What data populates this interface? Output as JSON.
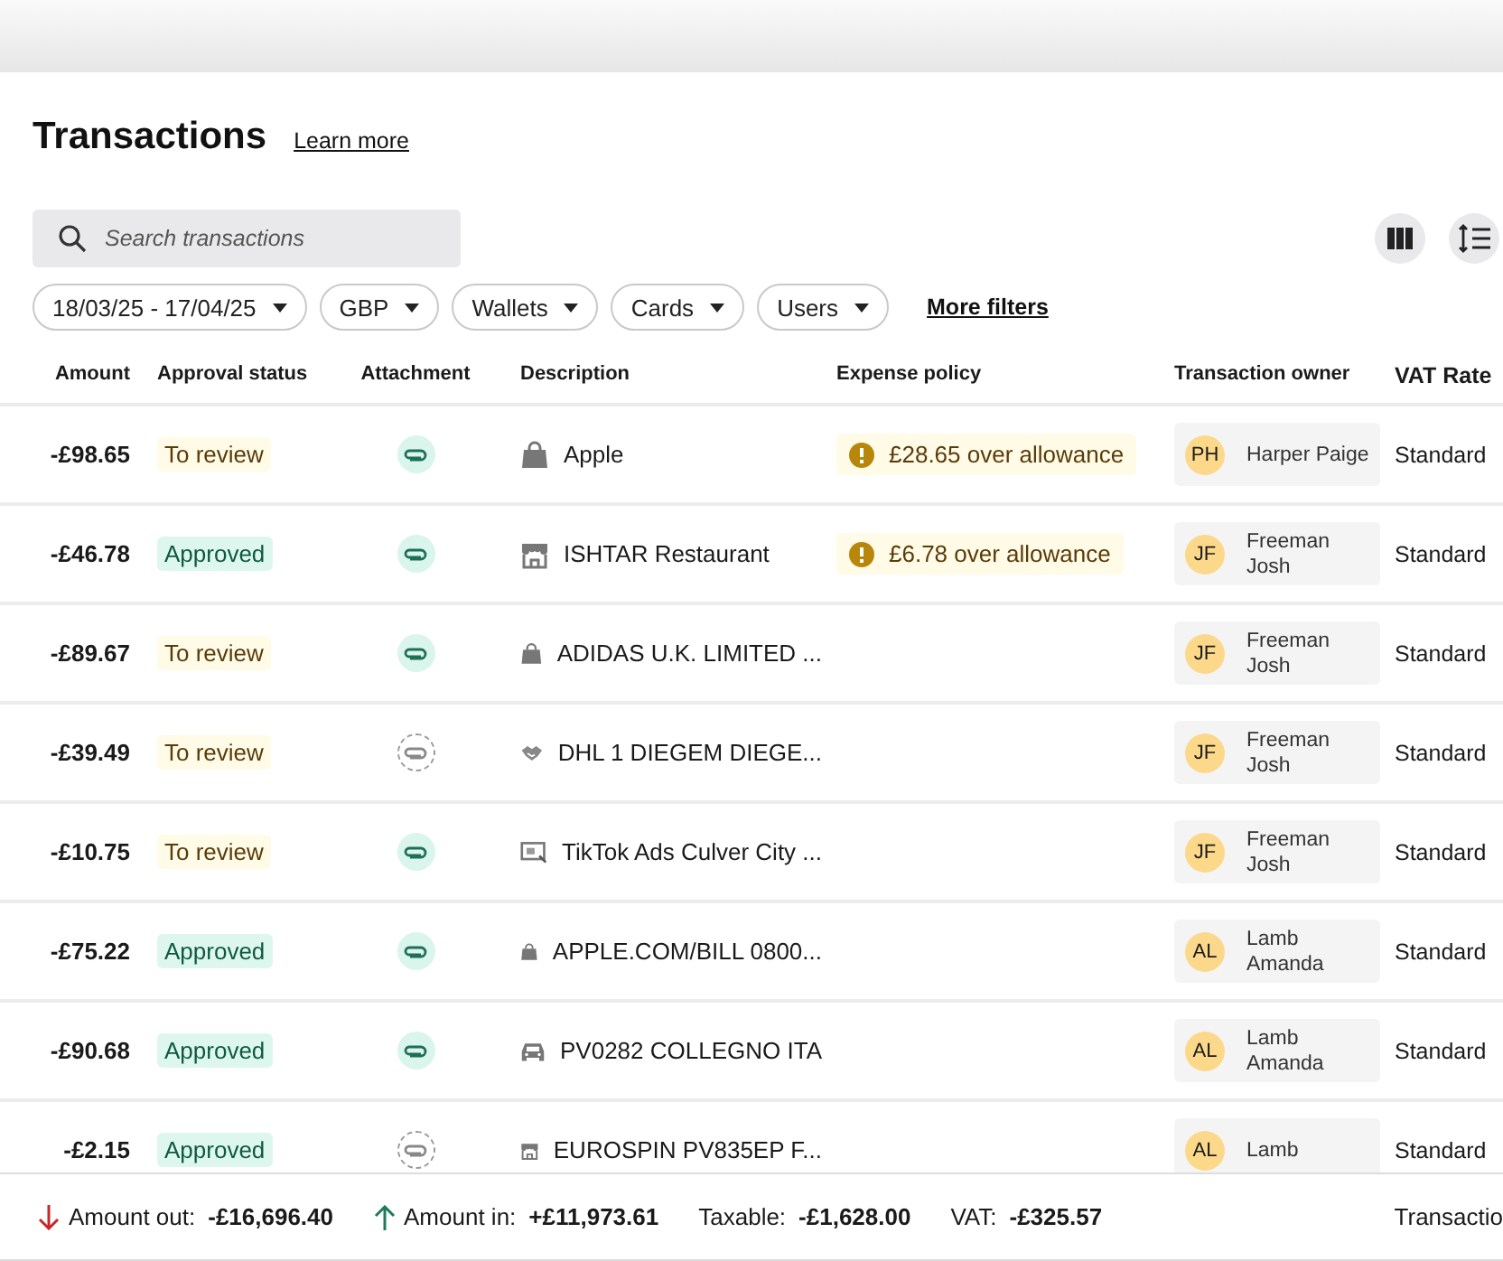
{
  "header": {
    "title": "Transactions",
    "learn_more": "Learn more"
  },
  "search": {
    "placeholder": "Search transactions"
  },
  "filters": [
    "18/03/25 - 17/04/25",
    "GBP",
    "Wallets",
    "Cards",
    "Users"
  ],
  "more_filters": "More filters",
  "table": {
    "columns": [
      "Amount",
      "Approval status",
      "Attachment",
      "Description",
      "Expense policy",
      "Transaction owner",
      "VAT Rate"
    ],
    "rows": [
      {
        "amount": "-£98.65",
        "status": "To review",
        "approved": false,
        "attached": true,
        "kind": "shopping",
        "description": "Apple",
        "policy": "£28.65 over allowance",
        "initials": "PH",
        "owner": [
          "Harper Paige"
        ],
        "vat": "Standard"
      },
      {
        "amount": "-£46.78",
        "status": "Approved",
        "approved": true,
        "attached": true,
        "kind": "store",
        "description": "ISHTAR Restaurant",
        "policy": "£6.78 over allowance",
        "initials": "JF",
        "owner": [
          "Freeman",
          "Josh"
        ],
        "vat": "Standard"
      },
      {
        "amount": "-£89.67",
        "status": "To review",
        "approved": false,
        "attached": true,
        "kind": "shopping",
        "description": "ADIDAS U.K. LIMITED ...",
        "initials": "JF",
        "owner": [
          "Freeman",
          "Josh"
        ],
        "vat": "Standard"
      },
      {
        "amount": "-£39.49",
        "status": "To review",
        "approved": false,
        "attached": false,
        "kind": "services",
        "description": "DHL 1 DIEGEM DIEGE...",
        "initials": "JF",
        "owner": [
          "Freeman",
          "Josh"
        ],
        "vat": "Standard"
      },
      {
        "amount": "-£10.75",
        "status": "To review",
        "approved": false,
        "attached": true,
        "kind": "advertising",
        "description": "TikTok Ads Culver City ...",
        "initials": "JF",
        "owner": [
          "Freeman",
          "Josh"
        ],
        "vat": "Standard"
      },
      {
        "amount": "-£75.22",
        "status": "Approved",
        "approved": true,
        "attached": true,
        "kind": "shopping",
        "description": "APPLE.COM/BILL 0800...",
        "initials": "AL",
        "owner": [
          "Lamb",
          "Amanda"
        ],
        "vat": "Standard"
      },
      {
        "amount": "-£90.68",
        "status": "Approved",
        "approved": true,
        "attached": true,
        "kind": "transport",
        "description": "PV0282 COLLEGNO ITA",
        "initials": "AL",
        "owner": [
          "Lamb",
          "Amanda"
        ],
        "vat": "Standard"
      },
      {
        "amount": "-£2.15",
        "status": "Approved",
        "approved": true,
        "attached": false,
        "kind": "store",
        "description": "EUROSPIN PV835EP F...",
        "initials": "AL",
        "owner": [
          "Lamb"
        ],
        "vat": "Standard"
      }
    ]
  },
  "footer": {
    "amount_out_label": "Amount out:",
    "amount_out": "-£16,696.40",
    "amount_in_label": "Amount in:",
    "amount_in": "+£11,973.61",
    "taxable_label": "Taxable:",
    "taxable": "-£1,628.00",
    "vat_label": "VAT:",
    "vat": "-£325.57",
    "transactions_label": "Transactio"
  }
}
